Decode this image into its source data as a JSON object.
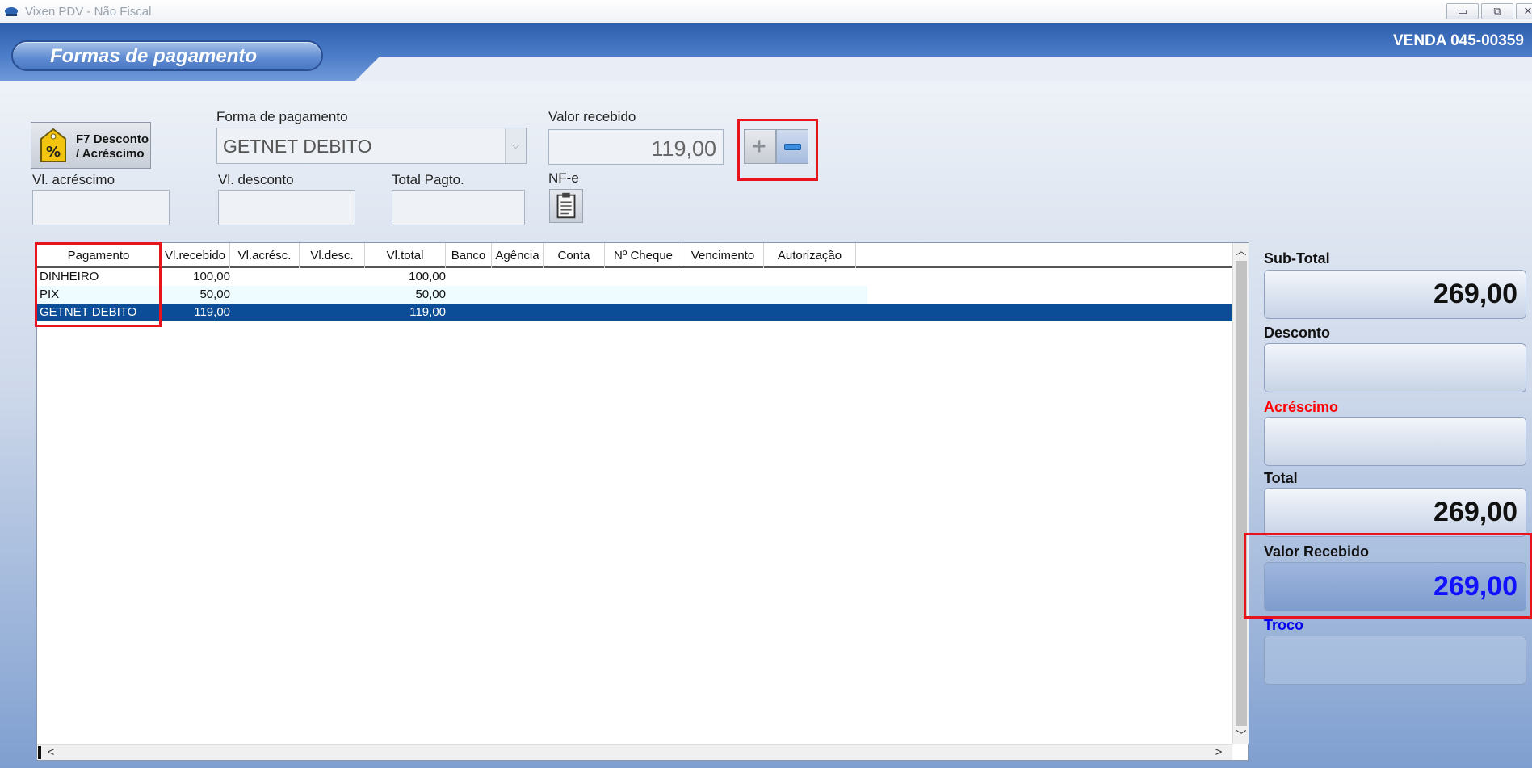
{
  "window": {
    "title": "Vixen PDV - Não Fiscal"
  },
  "header": {
    "section_title": "Formas de pagamento",
    "sale_number": "VENDA 045-00359"
  },
  "form": {
    "discount_button_label_1": "F7 Desconto",
    "discount_button_label_2": "/ Acréscimo",
    "forma_pagamento_label": "Forma de pagamento",
    "forma_pagamento_value": "GETNET DEBITO",
    "valor_recebido_label": "Valor recebido",
    "valor_recebido_value": "119,00",
    "vl_acrescimo_label": "Vl. acréscimo",
    "vl_acrescimo_value": "",
    "vl_desconto_label": "Vl. desconto",
    "vl_desconto_value": "",
    "total_pagto_label": "Total Pagto.",
    "total_pagto_value": "",
    "nfe_label": "NF-e"
  },
  "grid": {
    "columns": [
      "Pagamento",
      "Vl.recebido",
      "Vl.acrésc.",
      "Vl.desc.",
      "Vl.total",
      "Banco",
      "Agência",
      "Conta",
      "Nº Cheque",
      "Vencimento",
      "Autorização"
    ],
    "rows": [
      [
        "DINHEIRO",
        "100,00",
        "",
        "",
        "100,00",
        "",
        "",
        "",
        "",
        "",
        ""
      ],
      [
        "PIX",
        "50,00",
        "",
        "",
        "50,00",
        "",
        "",
        "",
        "",
        "",
        ""
      ],
      [
        "GETNET DEBITO",
        "119,00",
        "",
        "",
        "119,00",
        "",
        "",
        "",
        "",
        "",
        ""
      ]
    ],
    "selected_row": 2
  },
  "summary": {
    "subtotal_label": "Sub-Total",
    "subtotal_value": "269,00",
    "desconto_label": "Desconto",
    "desconto_value": "",
    "acrescimo_label": "Acréscimo",
    "acrescimo_value": "",
    "total_label": "Total",
    "total_value": "269,00",
    "valor_recebido_label": "Valor Recebido",
    "valor_recebido_value": "269,00",
    "troco_label": "Troco",
    "troco_value": ""
  },
  "colors": {
    "accent_red": "#e8141b",
    "selected_row": "#0b4d96",
    "valor_recebido_text": "#1111ff",
    "acrescimo_label": "#ff0000",
    "troco_label": "#0000ee"
  }
}
